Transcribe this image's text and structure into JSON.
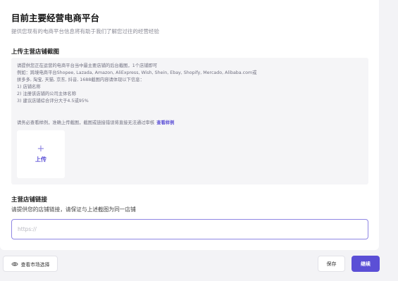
{
  "page": {
    "title": "目前主要经营电商平台",
    "subtitle": "提供您现有的电商平台信息将有助于我们了解您过往的经营经验"
  },
  "screenshot_section": {
    "title": "上传主营店铺截图",
    "instructions": [
      "请提供您正在运营的电商平台当中最主要店铺的后台截图，1个店铺即可",
      "例如：跨境电商平台Shopee, Lazada, Amazon, AliExpress, Wish, Shein, Ebay, Shopify, Mercado, Alibaba.com或",
      "拼多多, 淘宝, 天猫, 京东, 抖音, 1688截图内容请体现以下信息：",
      "1) 店铺名称",
      "2) 注册该店铺的公司主体名称",
      "3) 建议店铺综合评分大于4.5或95%"
    ],
    "note": "请务必查看样例，准确上传截图，截图或链接错误将直接无法通过审核",
    "sample_link": "查看样例",
    "upload_plus": "+",
    "upload_label": "上传"
  },
  "link_section": {
    "title": "主营店铺链接",
    "description": "请提供您的店铺链接，请保证与上述截图为同一店铺",
    "input_placeholder": "https://",
    "input_value": ""
  },
  "footer": {
    "market_button": "查看市场选择",
    "save_button": "保存",
    "continue_button": "继续"
  },
  "colors": {
    "accent": "#5b4fd6",
    "input_border": "#8f86e3",
    "panel_bg": "#f5f5f7",
    "page_bg": "#f3f3f6"
  }
}
